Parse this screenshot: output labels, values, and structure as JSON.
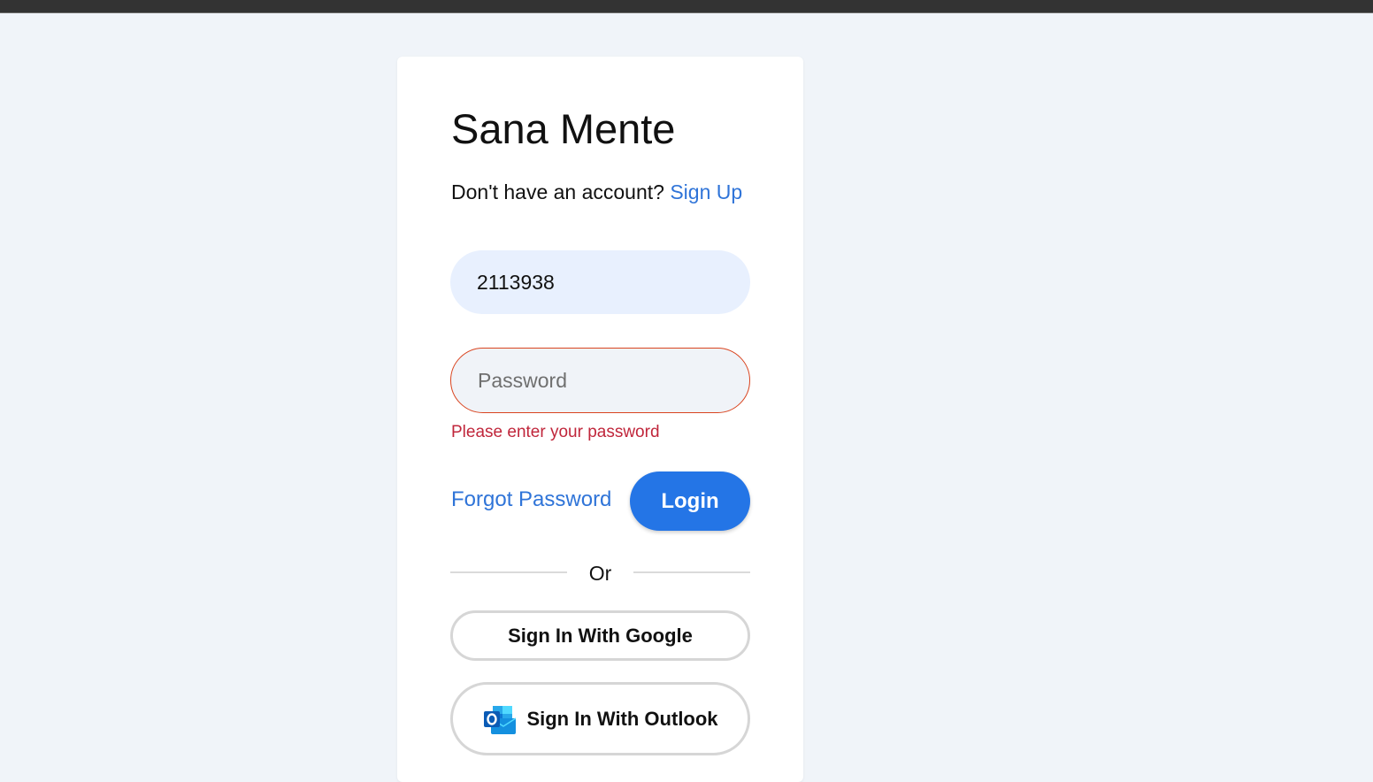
{
  "app": {
    "title": "Sana Mente"
  },
  "signup": {
    "prompt": "Don't have an account?",
    "link_label": "Sign Up"
  },
  "login_form": {
    "id_value": "2113938",
    "password_placeholder": "Password",
    "password_error": "Please enter your password",
    "forgot_label": "Forgot Password",
    "login_label": "Login"
  },
  "divider": {
    "label": "Or"
  },
  "sso": {
    "google_label": "Sign In With Google",
    "outlook_label": "Sign In With Outlook",
    "outlook_icon": "outlook-icon"
  },
  "colors": {
    "accent": "#2475e6",
    "link": "#2f74d8",
    "error": "#c0263b",
    "error_border": "#d9441f",
    "page_background": "#f0f4f9"
  }
}
